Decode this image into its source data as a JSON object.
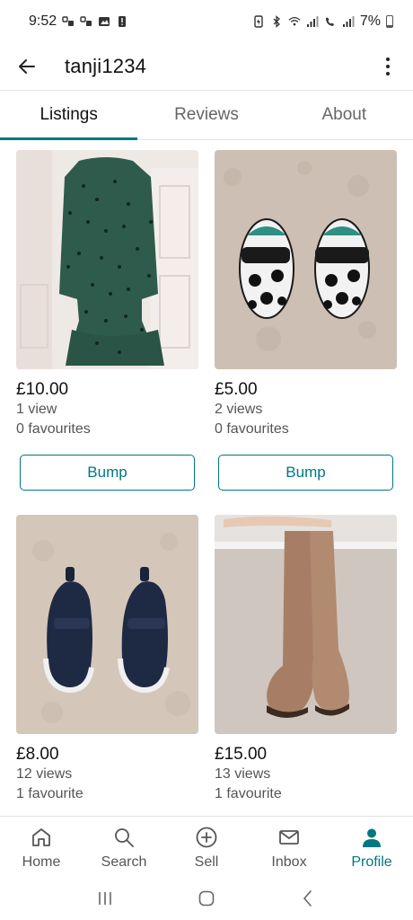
{
  "status_bar": {
    "time": "9:52",
    "battery": "7%"
  },
  "app_bar": {
    "title": "tanji1234"
  },
  "tabs": [
    {
      "label": "Listings",
      "active": true
    },
    {
      "label": "Reviews",
      "active": false
    },
    {
      "label": "About",
      "active": false
    }
  ],
  "listings": [
    {
      "price": "£10.00",
      "views": "1 view",
      "favourites": "0 favourites",
      "bump_label": "Bump",
      "image": "green-spotted-dress"
    },
    {
      "price": "£5.00",
      "views": "2 views",
      "favourites": "0 favourites",
      "bump_label": "Bump",
      "image": "football-slippers"
    },
    {
      "price": "£8.00",
      "views": "12 views",
      "favourites": "1 favourite",
      "image": "navy-trainers"
    },
    {
      "price": "£15.00",
      "views": "13 views",
      "favourites": "1 favourite",
      "image": "tan-knee-boots"
    }
  ],
  "bottom_nav": [
    {
      "label": "Home",
      "icon": "home-icon",
      "active": false
    },
    {
      "label": "Search",
      "icon": "search-icon",
      "active": false
    },
    {
      "label": "Sell",
      "icon": "plus-circle-icon",
      "active": false
    },
    {
      "label": "Inbox",
      "icon": "mail-icon",
      "active": false
    },
    {
      "label": "Profile",
      "icon": "person-icon",
      "active": true
    }
  ],
  "colors": {
    "accent": "#007782",
    "text": "#111111",
    "muted": "#555555"
  }
}
